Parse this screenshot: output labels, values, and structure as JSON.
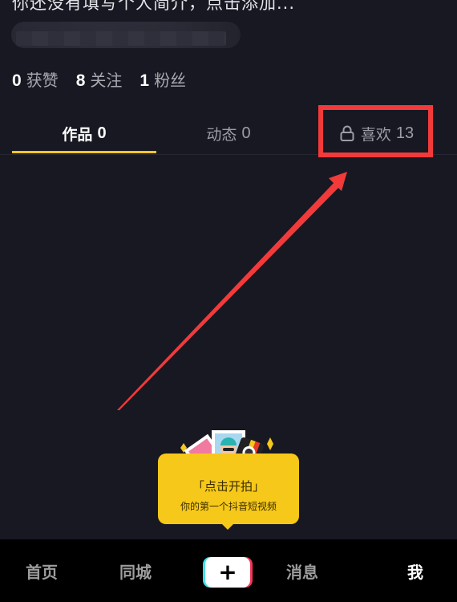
{
  "profile": {
    "bio_placeholder": "你还没有填写个人简介，点击添加...",
    "stats": [
      {
        "value": "0",
        "label": "获赞"
      },
      {
        "value": "8",
        "label": "关注"
      },
      {
        "value": "1",
        "label": "粉丝"
      }
    ]
  },
  "tabs": [
    {
      "label": "作品",
      "count": "0",
      "active": true
    },
    {
      "label": "动态",
      "count": "0",
      "active": false
    },
    {
      "label": "喜欢",
      "count": "13",
      "active": false,
      "icon": "lock-icon"
    }
  ],
  "prompt": {
    "title": "「点击开拍」",
    "subtitle": "你的第一个抖音短视频"
  },
  "bottom_nav": {
    "items": [
      {
        "label": "首页",
        "active": false
      },
      {
        "label": "同城",
        "active": false
      },
      {
        "label": "+",
        "active": false
      },
      {
        "label": "消息",
        "active": false
      },
      {
        "label": "我",
        "active": true
      }
    ]
  },
  "colors": {
    "background": "#171822",
    "accent": "#f2c527",
    "annotation": "#f23a3a",
    "bubble": "#f6c819"
  }
}
